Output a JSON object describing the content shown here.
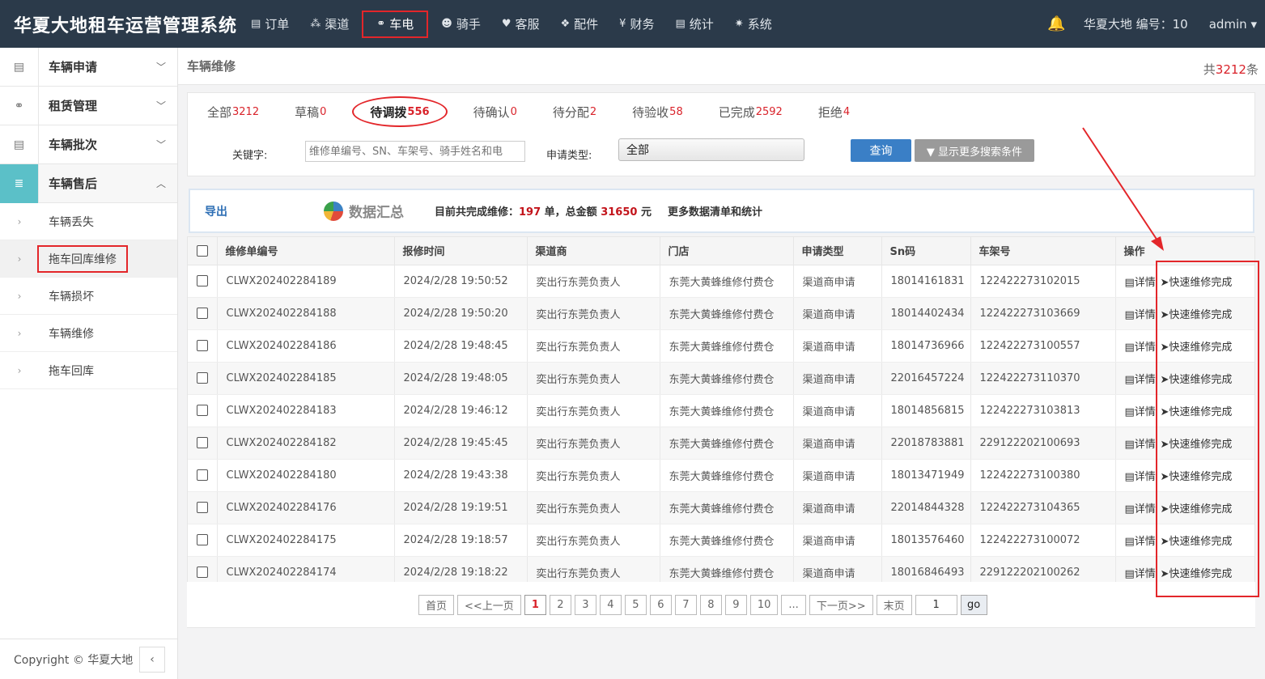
{
  "app": {
    "title": "华夏大地租车运营管理系统"
  },
  "topnav": [
    {
      "label": "订单",
      "icon": "table-icon",
      "glyph": "▤"
    },
    {
      "label": "渠道",
      "icon": "sitemap-icon",
      "glyph": "⁂"
    },
    {
      "label": "车电",
      "icon": "motorcycle-icon",
      "glyph": "⚭",
      "active": true
    },
    {
      "label": "骑手",
      "icon": "users-icon",
      "glyph": "☻"
    },
    {
      "label": "客服",
      "icon": "heart-icon",
      "glyph": "♥"
    },
    {
      "label": "配件",
      "icon": "cubes-icon",
      "glyph": "❖"
    },
    {
      "label": "财务",
      "icon": "yen-icon",
      "glyph": "¥"
    },
    {
      "label": "统计",
      "icon": "chart-icon",
      "glyph": "▤"
    },
    {
      "label": "系统",
      "icon": "gear-icon",
      "glyph": "✷"
    }
  ],
  "user": {
    "info": "华夏大地 编号：10",
    "name": "admin"
  },
  "sidebar": {
    "groups": [
      {
        "label": "车辆申请",
        "icon": "list-icon",
        "glyph": "▤"
      },
      {
        "label": "租赁管理",
        "icon": "motorcycle-icon",
        "glyph": "⚭"
      },
      {
        "label": "车辆批次",
        "icon": "list-icon",
        "glyph": "▤"
      },
      {
        "label": "车辆售后",
        "icon": "list-icon",
        "glyph": "≣",
        "active": true
      }
    ],
    "subitems": [
      {
        "label": "车辆丢失"
      },
      {
        "label": "拖车回库维修",
        "current": true
      },
      {
        "label": "车辆损坏"
      },
      {
        "label": "车辆维修"
      },
      {
        "label": "拖车回库"
      }
    ],
    "copyright": "Copyright © 华夏大地"
  },
  "page": {
    "title": "车辆维修",
    "total_prefix": "共",
    "total_count": "3212",
    "total_suffix": "条"
  },
  "tabs": [
    {
      "label": "全部",
      "count": "3212"
    },
    {
      "label": "草稿",
      "count": "0"
    },
    {
      "label": "待调拨",
      "count": "556",
      "active": true
    },
    {
      "label": "待确认",
      "count": "0"
    },
    {
      "label": "待分配",
      "count": "2"
    },
    {
      "label": "待验收",
      "count": "58"
    },
    {
      "label": "已完成",
      "count": "2592"
    },
    {
      "label": "拒绝",
      "count": "4"
    }
  ],
  "search": {
    "keyword_label": "关键字:",
    "keyword_placeholder": "维修单编号、SN、车架号、骑手姓名和电",
    "type_label": "申请类型:",
    "type_value": "全部",
    "query_button": "查询",
    "more_button": "▼ 显示更多搜索条件"
  },
  "summary": {
    "export": "导出",
    "title": "数据汇总",
    "text_prefix": "目前共完成维修：",
    "orders": "197",
    "text_mid": " 单，总金额 ",
    "amount": "31650",
    "text_suffix": " 元",
    "more": "更多数据清单和统计"
  },
  "table": {
    "columns": [
      "维修单编号",
      "报修时间",
      "渠道商",
      "门店",
      "申请类型",
      "Sn码",
      "车架号",
      "操作"
    ],
    "detail_label": "详情",
    "quick_label": "快速维修完成",
    "rows": [
      {
        "id": "CLWX202402284189",
        "time": "2024/2/28 19:50:52",
        "channel": "奕出行东莞负责人",
        "store": "东莞大黄蜂维修付费仓",
        "type": "渠道商申请",
        "sn": "18014161831",
        "frame": "122422273102015"
      },
      {
        "id": "CLWX202402284188",
        "time": "2024/2/28 19:50:20",
        "channel": "奕出行东莞负责人",
        "store": "东莞大黄蜂维修付费仓",
        "type": "渠道商申请",
        "sn": "18014402434",
        "frame": "122422273103669"
      },
      {
        "id": "CLWX202402284186",
        "time": "2024/2/28 19:48:45",
        "channel": "奕出行东莞负责人",
        "store": "东莞大黄蜂维修付费仓",
        "type": "渠道商申请",
        "sn": "18014736966",
        "frame": "122422273100557"
      },
      {
        "id": "CLWX202402284185",
        "time": "2024/2/28 19:48:05",
        "channel": "奕出行东莞负责人",
        "store": "东莞大黄蜂维修付费仓",
        "type": "渠道商申请",
        "sn": "22016457224",
        "frame": "122422273110370"
      },
      {
        "id": "CLWX202402284183",
        "time": "2024/2/28 19:46:12",
        "channel": "奕出行东莞负责人",
        "store": "东莞大黄蜂维修付费仓",
        "type": "渠道商申请",
        "sn": "18014856815",
        "frame": "122422273103813"
      },
      {
        "id": "CLWX202402284182",
        "time": "2024/2/28 19:45:45",
        "channel": "奕出行东莞负责人",
        "store": "东莞大黄蜂维修付费仓",
        "type": "渠道商申请",
        "sn": "22018783881",
        "frame": "229122202100693"
      },
      {
        "id": "CLWX202402284180",
        "time": "2024/2/28 19:43:38",
        "channel": "奕出行东莞负责人",
        "store": "东莞大黄蜂维修付费仓",
        "type": "渠道商申请",
        "sn": "18013471949",
        "frame": "122422273100380"
      },
      {
        "id": "CLWX202402284176",
        "time": "2024/2/28 19:19:51",
        "channel": "奕出行东莞负责人",
        "store": "东莞大黄蜂维修付费仓",
        "type": "渠道商申请",
        "sn": "22014844328",
        "frame": "122422273104365"
      },
      {
        "id": "CLWX202402284175",
        "time": "2024/2/28 19:18:57",
        "channel": "奕出行东莞负责人",
        "store": "东莞大黄蜂维修付费仓",
        "type": "渠道商申请",
        "sn": "18013576460",
        "frame": "122422273100072"
      },
      {
        "id": "CLWX202402284174",
        "time": "2024/2/28 19:18:22",
        "channel": "奕出行东莞负责人",
        "store": "东莞大黄蜂维修付费仓",
        "type": "渠道商申请",
        "sn": "18016846493",
        "frame": "229122202100262"
      }
    ]
  },
  "pager": {
    "first": "首页",
    "prev": "<<上一页",
    "pages": [
      "1",
      "2",
      "3",
      "4",
      "5",
      "6",
      "7",
      "8",
      "9",
      "10"
    ],
    "current": "1",
    "ellipsis": "...",
    "next": "下一页>>",
    "last": "末页",
    "input_value": "1",
    "go": "go"
  },
  "colors": {
    "navbar": "#2b3a4a",
    "accent": "#5bc0c8",
    "highlight": "#e3262a",
    "count_red": "#d9222a",
    "query_blue": "#3a7fc6"
  }
}
